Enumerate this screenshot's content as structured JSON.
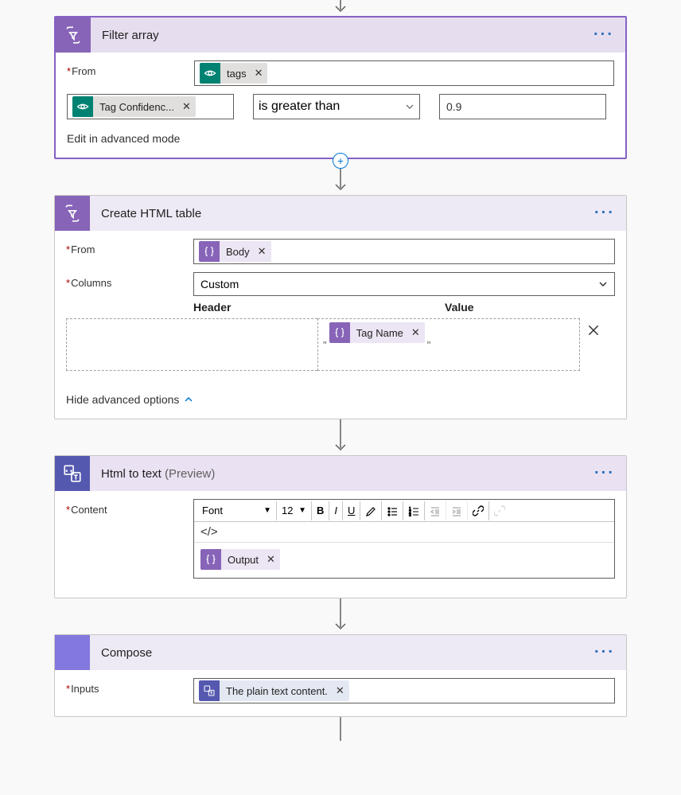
{
  "filter_array": {
    "title": "Filter array",
    "from_label": "From",
    "from_token": "tags",
    "condition_left_token": "Tag Confidenc...",
    "operator": "is greater than",
    "value": "0.9",
    "advanced_link": "Edit in advanced mode"
  },
  "create_html_table": {
    "title": "Create HTML table",
    "from_label": "From",
    "from_token": "Body",
    "columns_label": "Columns",
    "columns_mode": "Custom",
    "table_header_label": "Header",
    "table_value_label": "Value",
    "value_token": "Tag Name",
    "hide_link": "Hide advanced options"
  },
  "html_to_text": {
    "title": "Html to text",
    "preview": "(Preview)",
    "content_label": "Content",
    "font_label": "Font",
    "size_label": "12",
    "output_token": "Output"
  },
  "compose": {
    "title": "Compose",
    "inputs_label": "Inputs",
    "inputs_token": "The plain text content."
  }
}
